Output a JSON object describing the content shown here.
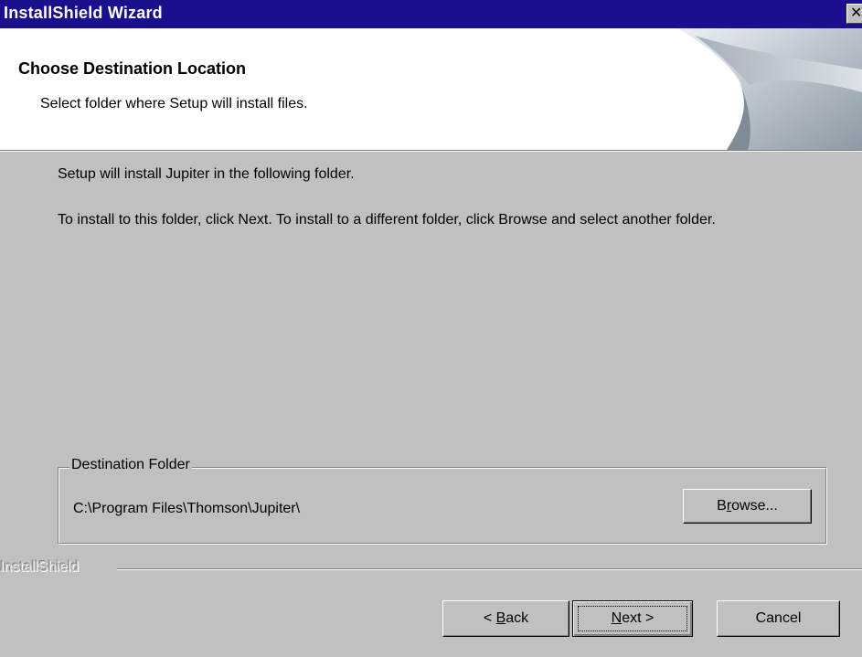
{
  "window": {
    "title": "InstallShield Wizard",
    "close_glyph": "✕",
    "title_color": "#1a0f8c"
  },
  "header": {
    "title": "Choose Destination Location",
    "subtitle": "Select folder where Setup will install files.",
    "graphic_icon": "page-curl-graphic"
  },
  "body": {
    "line1": "Setup will install Jupiter in the following folder.",
    "line2": "To install to this folder, click Next. To install to a different folder, click Browse and select another folder."
  },
  "destination": {
    "legend": "Destination Folder",
    "path": "C:\\Program Files\\Thomson\\Jupiter\\",
    "browse_pre": "B",
    "browse_ul": "r",
    "browse_post": "owse..."
  },
  "footer": {
    "brand": "InstallShield",
    "back_pre": "< ",
    "back_ul": "B",
    "back_post": "ack",
    "next_ul": "N",
    "next_post": "ext >",
    "cancel": "Cancel"
  }
}
